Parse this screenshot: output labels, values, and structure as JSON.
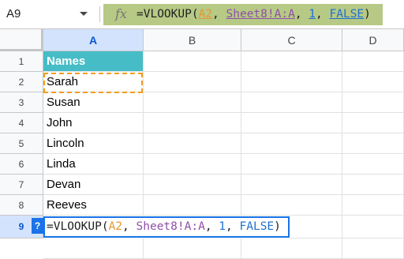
{
  "formula_bar": {
    "name_box": "A9",
    "fx_label": "fx",
    "formula": {
      "fn": "=VLOOKUP(",
      "ref1": "A2",
      "sep1": ", ",
      "ref2": "Sheet8!A:A",
      "sep2": ", ",
      "num": "1",
      "sep3": ", ",
      "bool": "FALSE",
      "close": ")"
    }
  },
  "columns": [
    "A",
    "B",
    "C",
    "D"
  ],
  "rows": [
    "1",
    "2",
    "3",
    "4",
    "5",
    "6",
    "7",
    "8",
    "9"
  ],
  "cells": {
    "A1": "Names",
    "A2": "Sarah",
    "A3": "Susan",
    "A4": "John",
    "A5": "Lincoln",
    "A6": "Linda",
    "A7": "Devan",
    "A8": "Reeves"
  },
  "editor": {
    "help_button": "?",
    "fn": "=VLOOKUP(",
    "ref1": "A2",
    "sep1": ", ",
    "ref2": "Sheet8!A:A",
    "sep2": ", ",
    "num": "1",
    "sep3": ", ",
    "bool": "FALSE",
    "close": ")"
  },
  "colors": {
    "header_fill": "#46bdc6",
    "selection_blue": "#1a73e8",
    "copy_marquee": "#f29b1d",
    "formula_highlight": "#b6c985"
  }
}
